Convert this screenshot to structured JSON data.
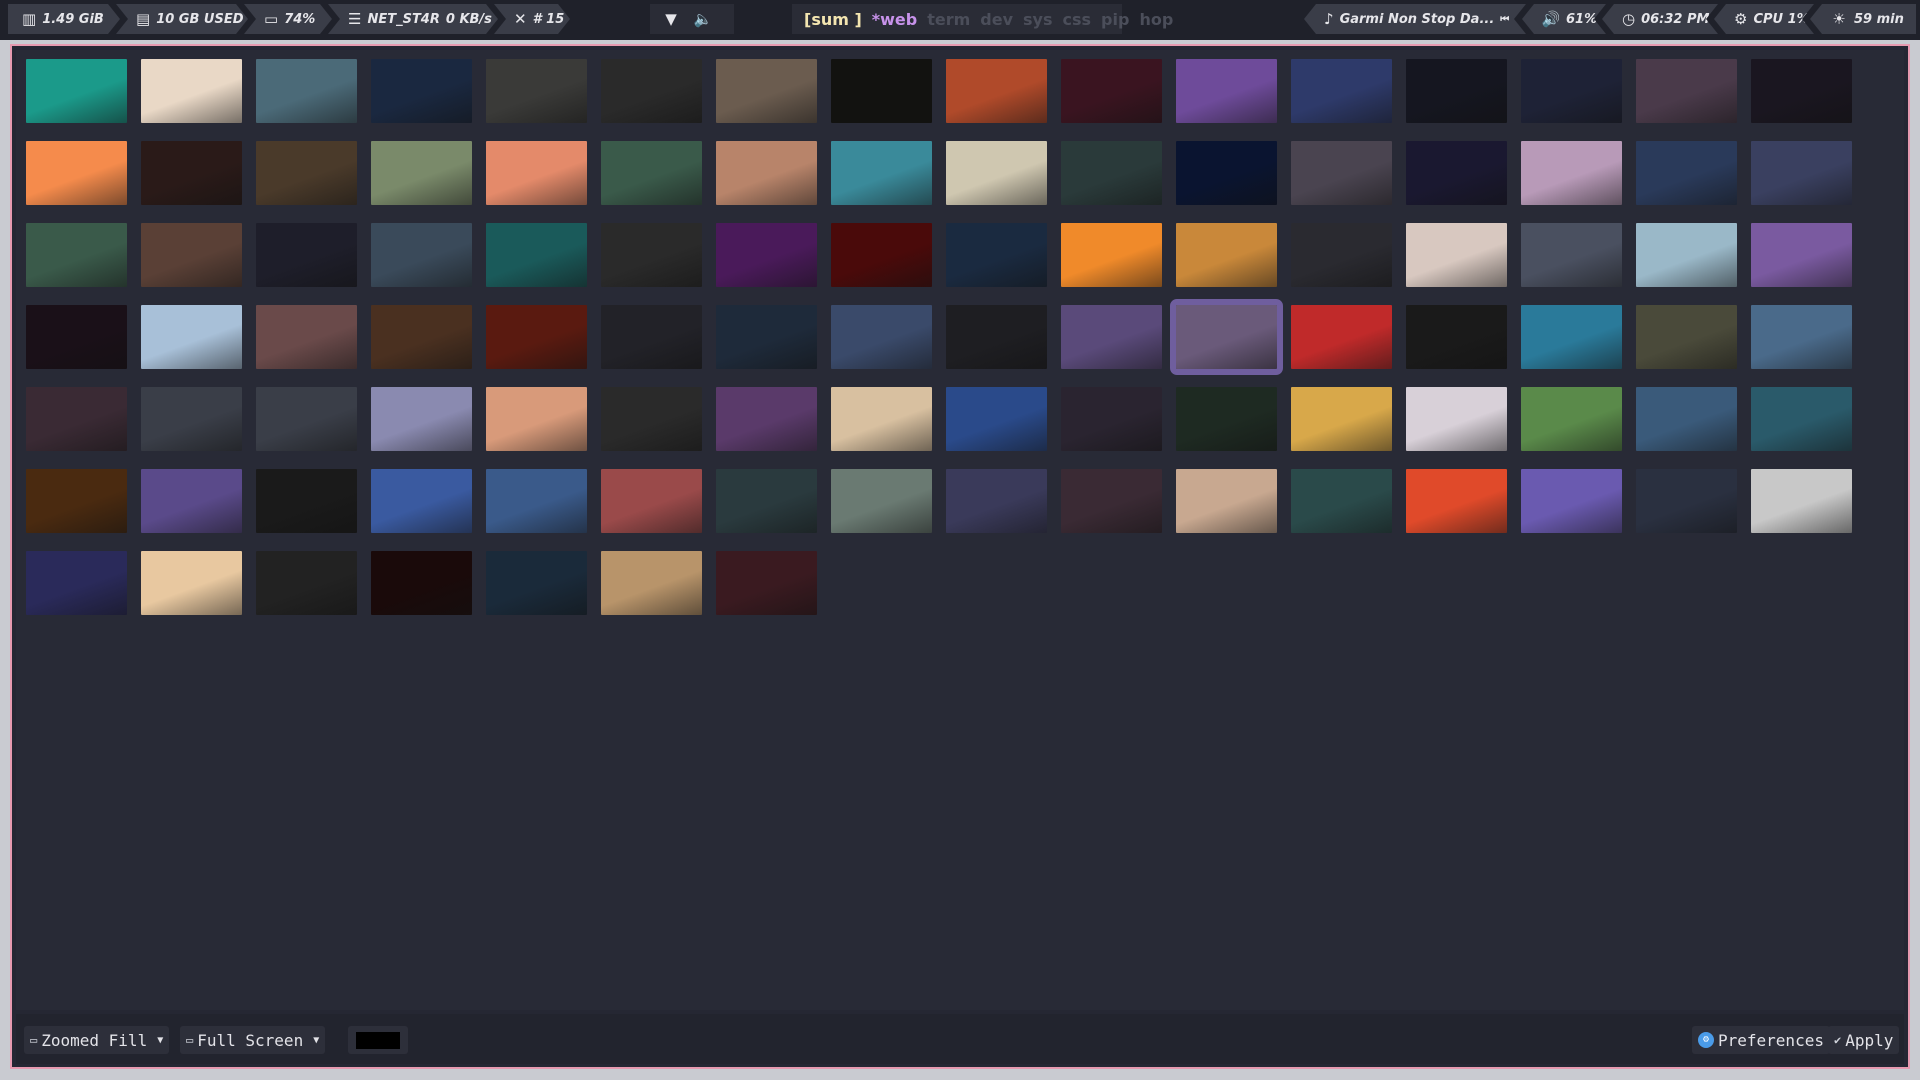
{
  "topbar": {
    "left": [
      {
        "icon": "memory-icon",
        "text": "1.49 GiB"
      },
      {
        "icon": "disk-icon",
        "text": "10 GB USED"
      },
      {
        "icon": "battery-icon",
        "text": "74%"
      },
      {
        "icon": "wifi-icon",
        "text": "NET_ST4R",
        "extra": "0 KB/s"
      },
      {
        "icon": "tools-icon",
        "text": "# 15"
      }
    ],
    "center_icons": [
      "triangle-down-icon",
      "volume-icon"
    ],
    "workspaces": {
      "active": "[sum ]",
      "current": "*web",
      "others": [
        "term",
        "dev",
        "sys",
        "css",
        "pip",
        "hop"
      ]
    },
    "right": [
      {
        "icon": "music-icon",
        "text": "Garmi Non Stop Da...",
        "controls": [
          "previous-icon",
          "pause-icon",
          "next-icon"
        ]
      },
      {
        "icon": "volume-icon",
        "text": "61%"
      },
      {
        "icon": "clock-icon",
        "text": "06:32 PM"
      },
      {
        "icon": "cpu-icon",
        "text": "CPU  1%"
      },
      {
        "icon": "brightness-icon",
        "text": "59 min"
      }
    ]
  },
  "colors": {
    "window_border": "#e79ab0",
    "selection": "#6f5e9e",
    "accent_workspace": "#c792ea",
    "workspace_active": "#f3e5b0"
  },
  "wallpapers": [
    [
      "#1b9a8a",
      "#e9d8c6",
      "#4b6a78",
      "#1a2840",
      "#3a3a38",
      "#2a2a2a",
      "#6b5c4f",
      "#121210",
      "#b04a2a",
      "#3a1420",
      "#6e4b9a",
      "#2e3a6a",
      "#151620",
      "#1e2236",
      "#4a3a4a",
      "#1a1620"
    ],
    [
      "#f58b4c",
      "#2a1a18",
      "#4a3a2a",
      "#7a8a6a",
      "#e48a6a",
      "#3a5a4a",
      "#b8846a",
      "#3a8a9a",
      "#cfc7b0",
      "#2a3a3a",
      "#0a1430",
      "#4a4450",
      "#1a1830",
      "#b89ab8",
      "#2a3a5a",
      "#3a4060"
    ],
    [
      "#3a5a4a",
      "#5a4036",
      "#1e1e2a",
      "#3a4a5a",
      "#1a5a5a",
      "#2a2a2a",
      "#4a1a5a",
      "#4a0a0a",
      "#1a2a40",
      "#f08a2a",
      "#c9883a",
      "#2a2a30",
      "#d8c8c0",
      "#4a5060",
      "#9ab8c8",
      "#7a5aa0"
    ],
    [
      "#1a1018",
      "#a8c0d8",
      "#6a4a4a",
      "#4a3020",
      "#5a1a10",
      "#222228",
      "#1e2a3a",
      "#3a4a6a",
      "#1e1e22",
      "#5a4a7a",
      "#6a5a7a",
      "#c02a2a",
      "#1a1a1a",
      "#2a7a9a",
      "#4a4a3a",
      "#4a6a8a"
    ],
    [
      "#3a2a34",
      "#3a3e48",
      "#3a3e48",
      "#8a8ab0",
      "#d89a7a",
      "#2a2a2a",
      "#5a3a6a",
      "#d8c0a0",
      "#2a4a8a",
      "#2a2430",
      "#1e2a22",
      "#d8a84a",
      "#d8d0d8",
      "#5a8a4a",
      "#3a5a7a",
      "#2a5a6a"
    ],
    [
      "#4a2a10",
      "#5a4a8a",
      "#1a1a1a",
      "#3a5aa0",
      "#3a5a8a",
      "#9a4a4a",
      "#2a3a3e",
      "#6a7a72",
      "#3a3a5a",
      "#3a2a34",
      "#c8a890",
      "#2a4a4a",
      "#e04a2a",
      "#6a5ab0",
      "#2a3040",
      "#c8c8c8"
    ],
    [
      "#2a2a5a",
      "#e8c8a0",
      "#222222",
      "#1a0a0a",
      "#1a2a3a",
      "#b8946a",
      "#3a1a20"
    ]
  ],
  "selected_index": {
    "row": 3,
    "col": 10
  },
  "toolbar": {
    "scale_mode": "Zoomed Fill",
    "screen_mode": "Full Screen",
    "background_color": "#000000",
    "preferences_label": "Preferences",
    "apply_label": "Apply"
  }
}
